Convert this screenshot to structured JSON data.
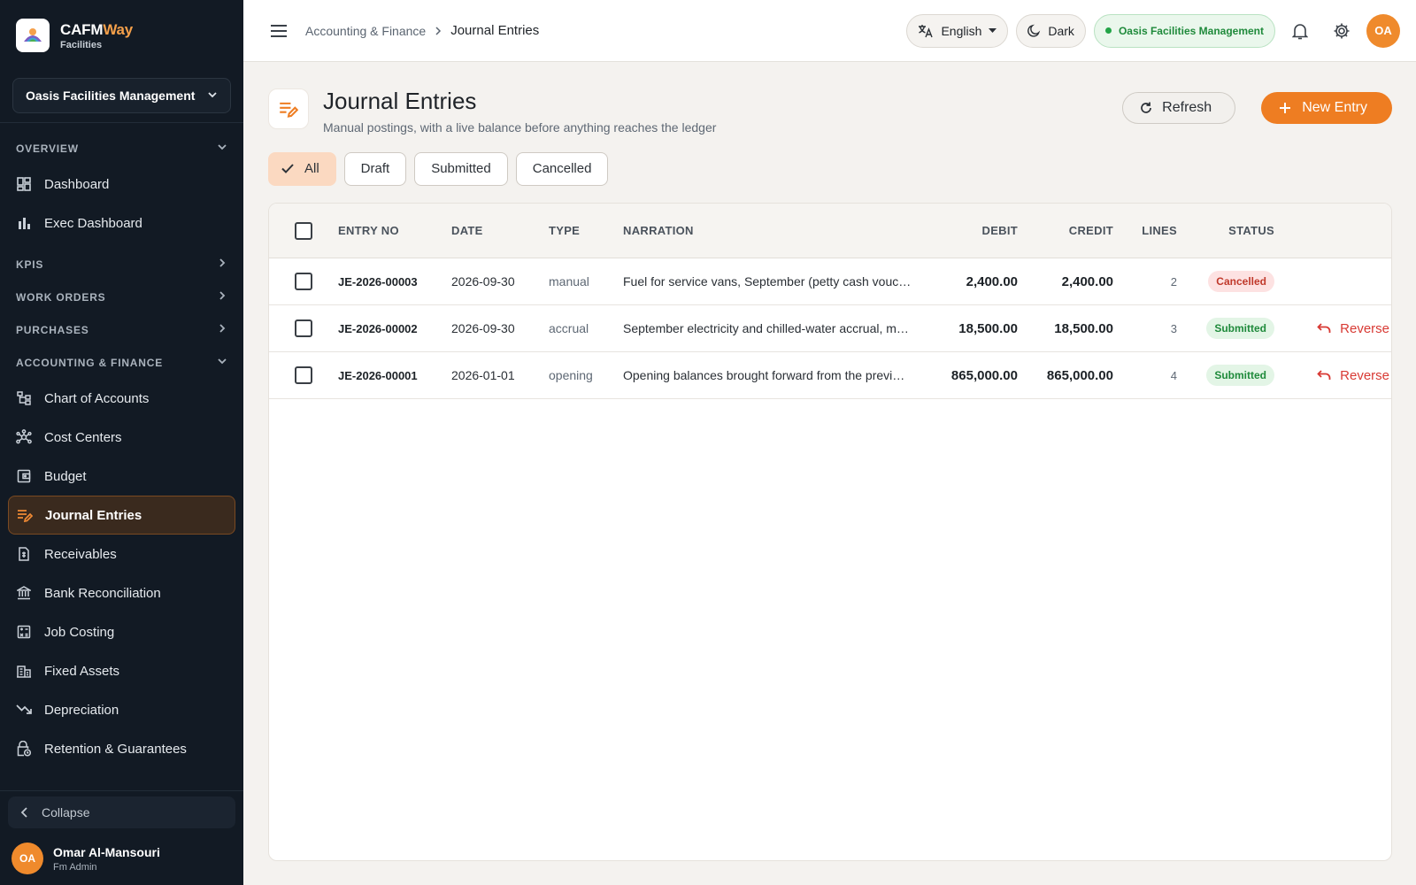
{
  "brand": {
    "name_main": "CAFM",
    "name_accent": "Way",
    "sub": "Facilities"
  },
  "org_selector": {
    "value": "Oasis Facilities Management"
  },
  "sidebar": {
    "sections": {
      "overview": "OVERVIEW",
      "kpis": "KPIS",
      "work_orders": "WORK ORDERS",
      "purchases": "PURCHASES",
      "accounting": "ACCOUNTING & FINANCE"
    },
    "overview_items": [
      {
        "label": "Dashboard",
        "icon": "dashboard-icon"
      },
      {
        "label": "Exec Dashboard",
        "icon": "bar-chart-icon"
      }
    ],
    "accounting_items": [
      {
        "label": "Chart of Accounts",
        "icon": "account-tree-icon"
      },
      {
        "label": "Cost Centers",
        "icon": "hub-icon"
      },
      {
        "label": "Budget",
        "icon": "wallet-icon"
      },
      {
        "label": "Journal Entries",
        "icon": "edit-note-icon",
        "active": true
      },
      {
        "label": "Receivables",
        "icon": "receipt-icon"
      },
      {
        "label": "Bank Reconciliation",
        "icon": "bank-icon"
      },
      {
        "label": "Job Costing",
        "icon": "calculator-icon"
      },
      {
        "label": "Fixed Assets",
        "icon": "building-icon"
      },
      {
        "label": "Depreciation",
        "icon": "trending-down-icon"
      },
      {
        "label": "Retention & Guarantees",
        "icon": "lock-clock-icon"
      }
    ],
    "collapse_label": "Collapse"
  },
  "user": {
    "initials": "OA",
    "name": "Omar Al-Mansouri",
    "role": "Fm Admin"
  },
  "topbar": {
    "breadcrumb": {
      "parent": "Accounting & Finance",
      "current": "Journal Entries"
    },
    "language": "English",
    "theme": "Dark",
    "org_pill": "Oasis Facilities Management",
    "avatar_initials": "OA"
  },
  "page": {
    "title": "Journal Entries",
    "subtitle": "Manual postings, with a live balance before anything reaches the ledger",
    "refresh_label": "Refresh",
    "new_label": "New Entry"
  },
  "filters": [
    {
      "label": "All",
      "active": true
    },
    {
      "label": "Draft"
    },
    {
      "label": "Submitted"
    },
    {
      "label": "Cancelled"
    }
  ],
  "table": {
    "headers": {
      "entry_no": "ENTRY NO",
      "date": "DATE",
      "type": "TYPE",
      "narration": "NARRATION",
      "debit": "DEBIT",
      "credit": "CREDIT",
      "lines": "LINES",
      "status": "STATUS"
    },
    "rows": [
      {
        "entry_no": "JE-2026-00003",
        "date": "2026-09-30",
        "type": "manual",
        "narration": "Fuel for service vans, September (petty cash voucher)",
        "debit": "2,400.00",
        "credit": "2,400.00",
        "lines": "2",
        "status": "Cancelled",
        "action": ""
      },
      {
        "entry_no": "JE-2026-00002",
        "date": "2026-09-30",
        "type": "accrual",
        "narration": "September electricity and chilled-water accrual, main campus",
        "debit": "18,500.00",
        "credit": "18,500.00",
        "lines": "3",
        "status": "Submitted",
        "action": "Reverse"
      },
      {
        "entry_no": "JE-2026-00001",
        "date": "2026-01-01",
        "type": "opening",
        "narration": "Opening balances brought forward from the previous year",
        "debit": "865,000.00",
        "credit": "865,000.00",
        "lines": "4",
        "status": "Submitted",
        "action": "Reverse"
      }
    ]
  },
  "colors": {
    "accent": "#ee7d22",
    "sidebar_bg": "#121a24",
    "success": "#1f8a3b",
    "danger": "#d83a34"
  }
}
